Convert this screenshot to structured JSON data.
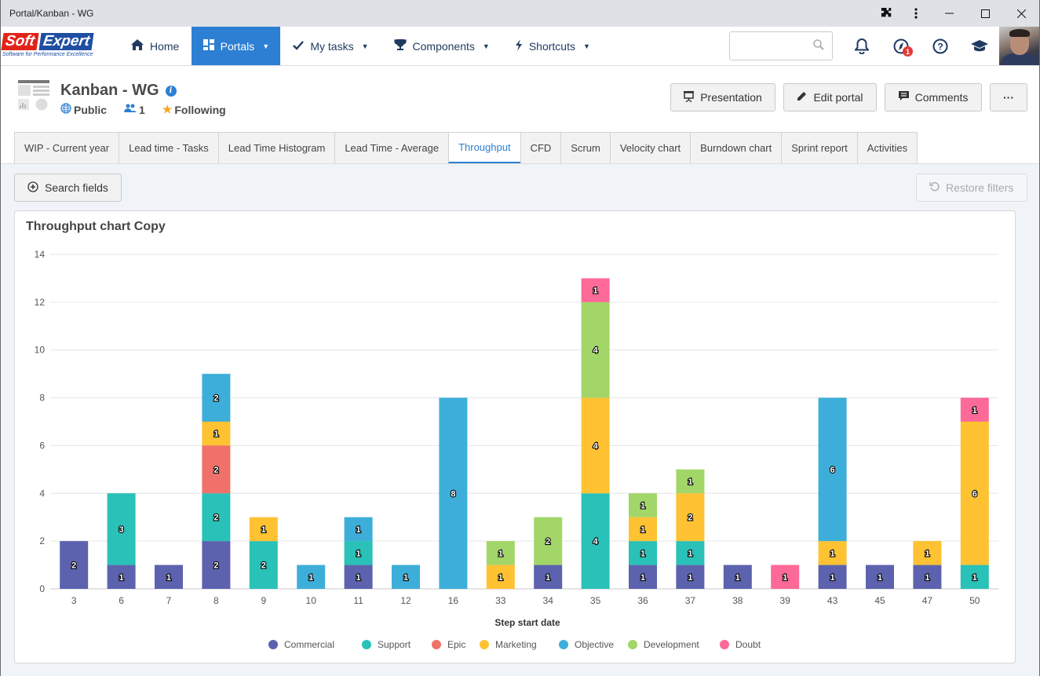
{
  "window": {
    "title": "Portal/Kanban - WG",
    "controls": [
      "extensions-icon",
      "menu-icon",
      "minimize",
      "maximize",
      "close"
    ]
  },
  "navbar": {
    "logo": {
      "line1a": "Soft",
      "line1b": "Expert",
      "tagline": "Software for Performance Excellence"
    },
    "items": [
      {
        "label": "Home",
        "icon": "home-icon",
        "dropdown": false,
        "active": false
      },
      {
        "label": "Portals",
        "icon": "portals-icon",
        "dropdown": true,
        "active": true
      },
      {
        "label": "My tasks",
        "icon": "check-icon",
        "dropdown": true,
        "active": false
      },
      {
        "label": "Components",
        "icon": "trophy-icon",
        "dropdown": true,
        "active": false
      },
      {
        "label": "Shortcuts",
        "icon": "bolt-icon",
        "dropdown": true,
        "active": false
      }
    ],
    "search": {
      "value": "",
      "placeholder": ""
    },
    "notification_badge": "1"
  },
  "header": {
    "title": "Kanban - WG",
    "visibility": "Public",
    "members": "1",
    "following": "Following",
    "buttons": {
      "presentation": "Presentation",
      "edit": "Edit portal",
      "comments": "Comments",
      "more": "···"
    }
  },
  "tabs": [
    {
      "label": "WIP - Current year",
      "active": false
    },
    {
      "label": "Lead time - Tasks",
      "active": false
    },
    {
      "label": "Lead Time Histogram",
      "active": false
    },
    {
      "label": "Lead Time - Average",
      "active": false
    },
    {
      "label": "Throughput",
      "active": true
    },
    {
      "label": "CFD",
      "active": false
    },
    {
      "label": "Scrum",
      "active": false
    },
    {
      "label": "Velocity chart",
      "active": false
    },
    {
      "label": "Burndown chart",
      "active": false
    },
    {
      "label": "Sprint report",
      "active": false
    },
    {
      "label": "Activities",
      "active": false
    }
  ],
  "toolbar": {
    "search_fields": "Search fields",
    "restore_filters": "Restore filters"
  },
  "card": {
    "title": "Throughput chart Copy"
  },
  "chart_data": {
    "type": "bar",
    "stacked": true,
    "title": "Throughput chart Copy",
    "xlabel": "Step start date",
    "ylabel": "",
    "ylim": [
      0,
      14
    ],
    "yticks": [
      0,
      2,
      4,
      6,
      8,
      10,
      12,
      14
    ],
    "grid": true,
    "legend_position": "bottom",
    "data_labels": true,
    "categories": [
      "3",
      "6",
      "7",
      "8",
      "9",
      "10",
      "11",
      "12",
      "16",
      "33",
      "34",
      "35",
      "36",
      "37",
      "38",
      "39",
      "43",
      "45",
      "47",
      "50"
    ],
    "series": [
      {
        "name": "Commercial",
        "color": "#5c62ad",
        "values": [
          2,
          1,
          1,
          2,
          0,
          0,
          1,
          0,
          0,
          0,
          1,
          0,
          1,
          1,
          1,
          0,
          1,
          1,
          1,
          0
        ]
      },
      {
        "name": "Support",
        "color": "#29c1b8",
        "values": [
          0,
          3,
          0,
          2,
          2,
          0,
          1,
          0,
          0,
          0,
          0,
          4,
          1,
          1,
          0,
          0,
          0,
          0,
          0,
          1
        ]
      },
      {
        "name": "Epic",
        "color": "#ef7169",
        "values": [
          0,
          0,
          0,
          2,
          0,
          0,
          0,
          0,
          0,
          0,
          0,
          0,
          0,
          0,
          0,
          0,
          0,
          0,
          0,
          0
        ]
      },
      {
        "name": "Marketing",
        "color": "#fec232",
        "values": [
          0,
          0,
          0,
          1,
          1,
          0,
          0,
          0,
          0,
          1,
          0,
          4,
          1,
          2,
          0,
          0,
          1,
          0,
          1,
          6
        ]
      },
      {
        "name": "Objective",
        "color": "#3daed9",
        "values": [
          0,
          0,
          0,
          2,
          0,
          1,
          1,
          1,
          8,
          0,
          0,
          0,
          0,
          0,
          0,
          0,
          6,
          0,
          0,
          0
        ]
      },
      {
        "name": "Development",
        "color": "#a2d669",
        "values": [
          0,
          0,
          0,
          0,
          0,
          0,
          0,
          0,
          0,
          1,
          2,
          4,
          1,
          1,
          0,
          0,
          0,
          0,
          0,
          0
        ]
      },
      {
        "name": "Doubt",
        "color": "#fd6a97",
        "values": [
          0,
          0,
          0,
          0,
          0,
          0,
          0,
          0,
          0,
          0,
          0,
          1,
          0,
          0,
          0,
          1,
          0,
          0,
          0,
          1
        ]
      }
    ]
  }
}
